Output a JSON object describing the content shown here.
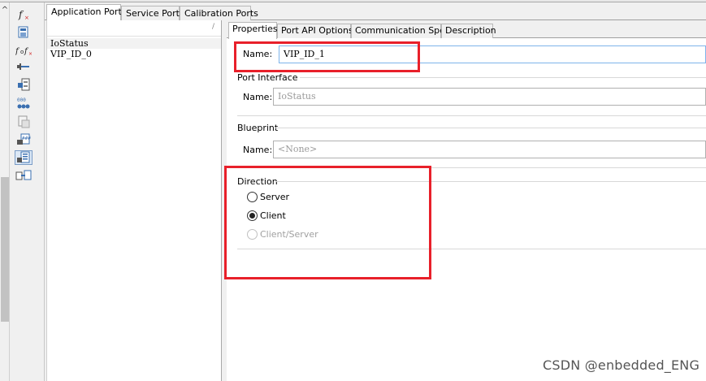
{
  "toolbar": {
    "icons": [
      "function-icon",
      "save-port-icon",
      "function-compose-icon",
      "connector-icon",
      "component-icon",
      "ports-grid-icon",
      "file-icon",
      "port-add-icon",
      "port-list-icon",
      "port-map-icon"
    ],
    "accent_color": "#3a6fb0"
  },
  "ports_tabs": {
    "items": [
      "Application Ports",
      "Service Ports",
      "Calibration Ports"
    ],
    "active": "Application Ports"
  },
  "ports_list": {
    "sort_indicator": "/",
    "items": [
      "IoStatus",
      "VIP_ID_0"
    ]
  },
  "props_tabs": {
    "items": [
      "Properties",
      "Port API Options",
      "Communication Spec",
      "Description"
    ],
    "active": "Properties"
  },
  "properties": {
    "name_label": "Name:",
    "name_value": "VIP_ID_1",
    "port_interface": {
      "title": "Port Interface",
      "name_label": "Name:",
      "name_value": "IoStatus"
    },
    "blueprint": {
      "title": "Blueprint",
      "name_label": "Name:",
      "name_value": "<None>"
    },
    "direction": {
      "title": "Direction",
      "options": [
        {
          "label": "Server",
          "checked": false,
          "enabled": true
        },
        {
          "label": "Client",
          "checked": true,
          "enabled": true
        },
        {
          "label": "Client/Server",
          "checked": false,
          "enabled": false
        }
      ]
    }
  },
  "annotation_color": "#e8202a",
  "watermark": "CSDN @enbedded_ENG"
}
